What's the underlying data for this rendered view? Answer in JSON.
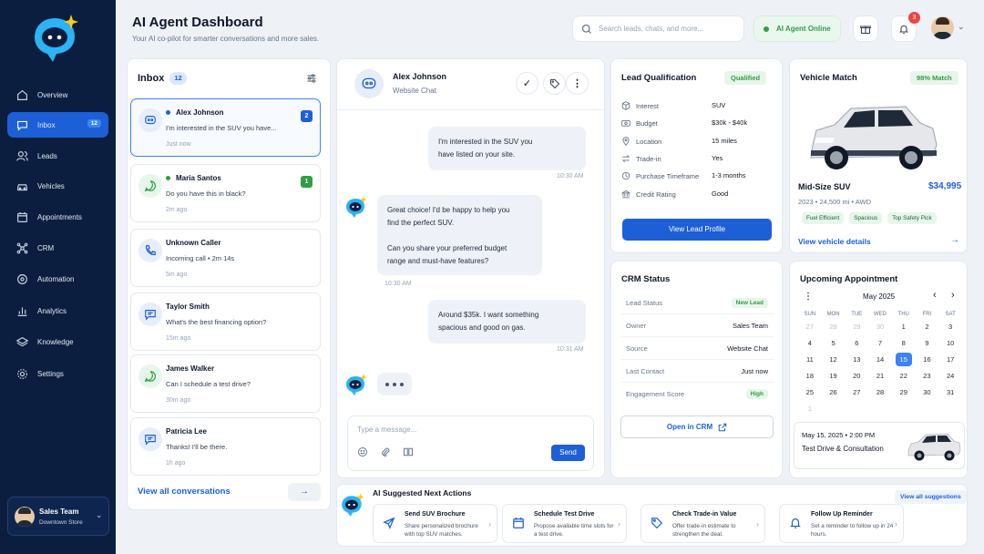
{
  "header": {
    "title": "AI Agent Dashboard",
    "subtitle": "Your AI co-pilot for smarter conversations and more sales.",
    "search_placeholder": "Search leads, chats, and more...",
    "status": "AI Agent Online",
    "notif_count": "3"
  },
  "sidebar": {
    "items": [
      {
        "label": "Overview",
        "icon": "home-icon"
      },
      {
        "label": "Inbox",
        "icon": "inbox-icon",
        "badge": "12"
      },
      {
        "label": "Leads",
        "icon": "users-icon"
      },
      {
        "label": "Vehicles",
        "icon": "car-icon"
      },
      {
        "label": "Appointments",
        "icon": "calendar-icon"
      },
      {
        "label": "CRM",
        "icon": "crm-icon"
      },
      {
        "label": "Automation",
        "icon": "automation-icon"
      },
      {
        "label": "Analytics",
        "icon": "analytics-icon"
      },
      {
        "label": "Knowledge",
        "icon": "layers-icon"
      },
      {
        "label": "Settings",
        "icon": "gear-icon"
      }
    ],
    "user": {
      "name": "Sales Team",
      "location": "Downtown Store"
    }
  },
  "inbox": {
    "title": "Inbox",
    "count": "12",
    "view_all": "View all conversations",
    "items": [
      {
        "name": "Alex Johnson",
        "message": "I'm interested in the SUV you have...",
        "time": "Just now",
        "badge": "2"
      },
      {
        "name": "Maria Santos",
        "message": "Do you have this in black?",
        "time": "2m ago",
        "badge": "1"
      },
      {
        "name": "Unknown Caller",
        "message": "Incoming call  •  2m 14s",
        "time": "5m ago"
      },
      {
        "name": "Taylor Smith",
        "message": "What's the best financing option?",
        "time": "15m ago"
      },
      {
        "name": "James Walker",
        "message": "Can I schedule a test drive?",
        "time": "30m ago"
      },
      {
        "name": "Patricia Lee",
        "message": "Thanks! I'll be there.",
        "time": "1h ago"
      }
    ]
  },
  "chat": {
    "name": "Alex Johnson",
    "source": "Website Chat",
    "input_placeholder": "Type a message...",
    "send": "Send",
    "messages": [
      {
        "from": "customer",
        "text1": "I'm interested in the SUV you",
        "text2": "have listed on your site.",
        "time": "10:30 AM"
      },
      {
        "from": "agent",
        "text1": "Great choice! I'd be happy to help you",
        "text2": "find the perfect SUV.",
        "text3": "Can you share your preferred budget",
        "text4": "range and must-have features?",
        "time": "10:30 AM"
      },
      {
        "from": "customer",
        "text1": "Around $35k. I want something",
        "text2": "spacious and good on gas.",
        "time": "10:31 AM"
      }
    ]
  },
  "lead": {
    "title": "Lead Qualification",
    "status": "Qualified",
    "button": "View Lead Profile",
    "rows": [
      {
        "label": "Interest",
        "value": "SUV"
      },
      {
        "label": "Budget",
        "value": "$30k - $40k"
      },
      {
        "label": "Location",
        "value": "15 miles"
      },
      {
        "label": "Trade-in",
        "value": "Yes"
      },
      {
        "label": "Purchase Timeframe",
        "value": "1-3 months"
      },
      {
        "label": "Credit Rating",
        "value": "Good"
      }
    ]
  },
  "vehicle": {
    "title": "Vehicle Match",
    "match": "98% Match",
    "name": "Mid-Size SUV",
    "price": "$34,995",
    "specs": "2023  •  24,500 mi  •  AWD",
    "tags": [
      "Fuel Efficient",
      "Spacious",
      "Top Safety Pick"
    ],
    "link": "View vehicle details"
  },
  "crm": {
    "title": "CRM Status",
    "open": "Open in CRM",
    "rows": [
      {
        "label": "Lead Status",
        "value": "New Lead"
      },
      {
        "label": "Owner",
        "value": "Sales Team"
      },
      {
        "label": "Source",
        "value": "Website Chat"
      },
      {
        "label": "Last Contact",
        "value": "Just now"
      },
      {
        "label": "Engagement Score",
        "value": "High"
      }
    ]
  },
  "appointment": {
    "title": "Upcoming Appointment",
    "month": "May 2025",
    "weekdays": [
      "SUN",
      "MON",
      "TUE",
      "WED",
      "THU",
      "FRI",
      "SAT"
    ],
    "date": "May 15, 2025  •  2:00 PM",
    "event": "Test Drive & Consultation"
  },
  "suggestions": {
    "title": "AI Suggested Next Actions",
    "view_all": "View all suggestions",
    "items": [
      {
        "title": "Send SUV Brochure",
        "desc": "Share personalized brochure with top SUV matches."
      },
      {
        "title": "Schedule Test Drive",
        "desc": "Propose available time slots for a test drive."
      },
      {
        "title": "Check Trade-in Value",
        "desc": "Offer trade-in estimate to strengthen the deal."
      },
      {
        "title": "Follow Up Reminder",
        "desc": "Set a reminder to follow up in 24 hours."
      }
    ]
  },
  "colors": {
    "accent": "#1d5fd6",
    "sidebar": "#0b1e3f",
    "success": "#2f9e44"
  }
}
